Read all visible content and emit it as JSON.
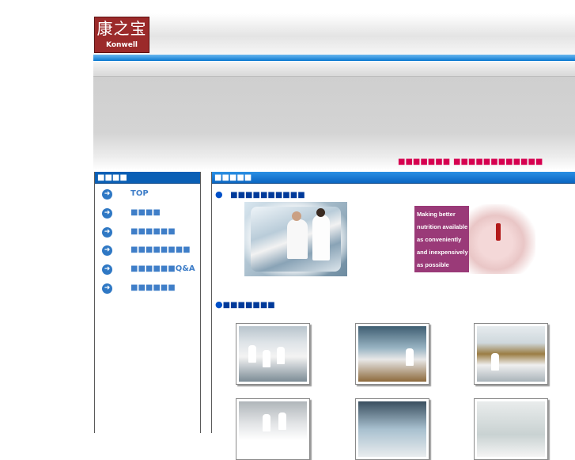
{
  "header": {
    "logo": {
      "chinese": "康之宝",
      "english": "Konwell"
    }
  },
  "top_links": [
    "■■■■■■■",
    "■■■■■■■■■■■■"
  ],
  "sidebar": {
    "title": "■■■■",
    "items": [
      {
        "label": "TOP",
        "icon": "arrow-right-circle-icon"
      },
      {
        "label": "■■■■",
        "icon": "arrow-right-circle-icon"
      },
      {
        "label": "■■■■■■",
        "icon": "arrow-right-circle-icon"
      },
      {
        "label": "■■■■■■■■",
        "icon": "arrow-right-circle-icon"
      },
      {
        "label": "■■■■■■Q&A",
        "icon": "arrow-right-circle-icon"
      },
      {
        "label": "■■■■■■",
        "icon": "arrow-right-circle-icon"
      }
    ]
  },
  "main": {
    "title": "■■■■■",
    "section1": {
      "bullet": "●",
      "heading": "■■■■■■■■■■"
    },
    "section2": {
      "bullet": "●",
      "heading": "■■■■■■■"
    },
    "feature_card_lines": [
      "Making better",
      "nutrition available",
      "as conveniently",
      "and inexpensively",
      "as possible"
    ]
  },
  "colors": {
    "brand_red": "#9b2a2a",
    "accent_blue": "#0b79d0",
    "link_pink": "#d6004f",
    "nav_blue": "#3f7ec8"
  }
}
